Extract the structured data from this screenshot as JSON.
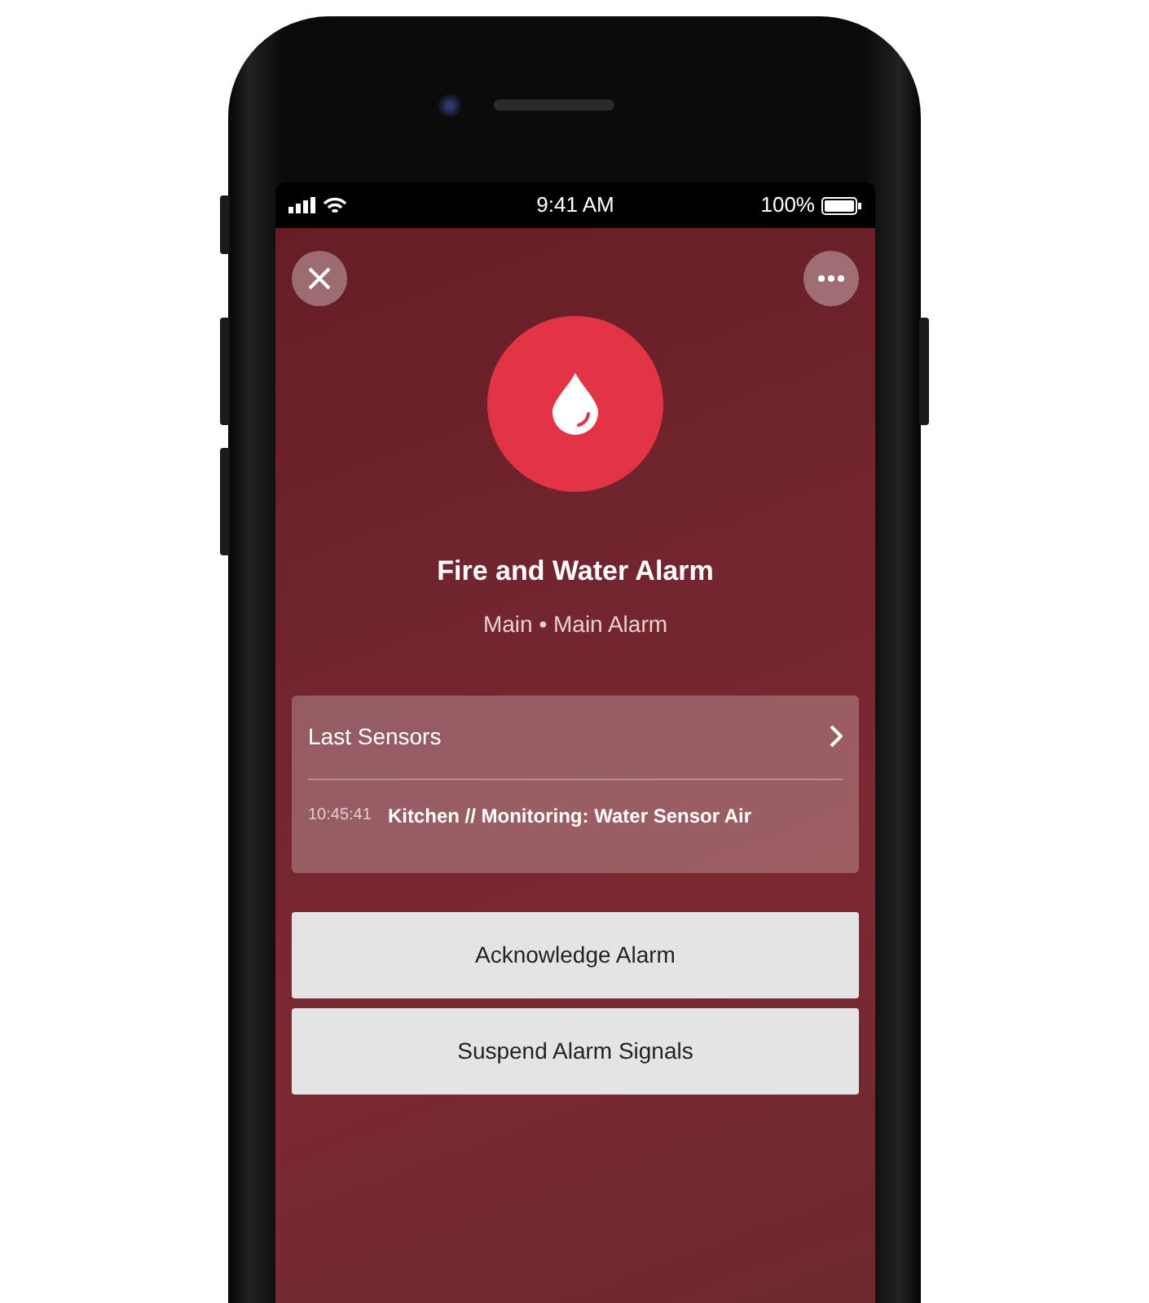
{
  "status_bar": {
    "time": "9:41 AM",
    "battery": "100%"
  },
  "alarm": {
    "title": "Fire and Water Alarm",
    "subtitle": "Main • Main Alarm"
  },
  "last_sensors": {
    "title": "Last Sensors",
    "entries": [
      {
        "time": "10:45:41",
        "text": "Kitchen // Monitoring: Water Sensor Air"
      }
    ]
  },
  "buttons": [
    "Acknowledge Alarm",
    "Suspend Alarm Signals"
  ]
}
